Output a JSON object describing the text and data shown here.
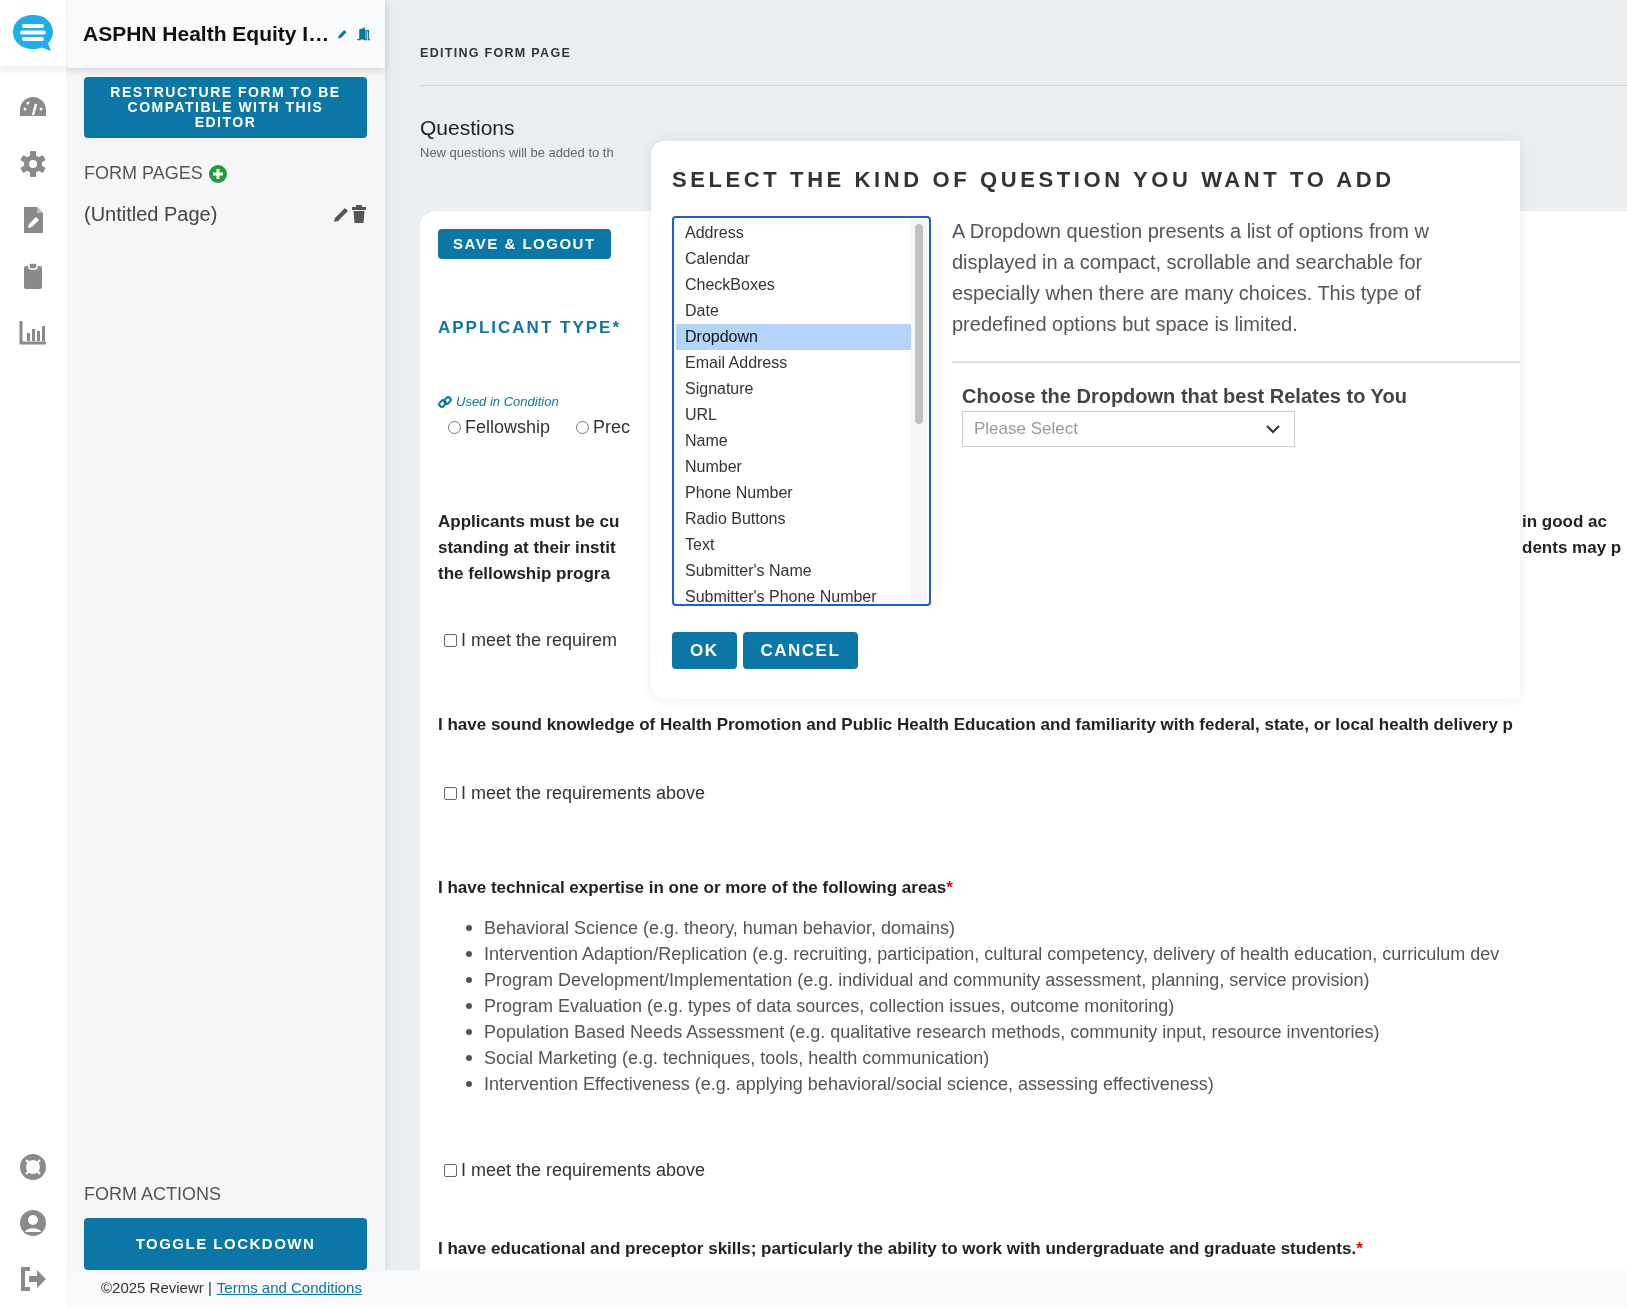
{
  "sidebar": {
    "title": "ASPHN Health Equity I…",
    "restructure_button": "RESTRUCTURE FORM TO BE COMPATIBLE WITH THIS EDITOR",
    "form_pages_heading": "FORM PAGES",
    "pages": [
      {
        "label": "(Untitled Page)"
      }
    ],
    "form_actions_heading": "FORM ACTIONS",
    "actions": [
      "TOGGLE LOCKDOWN"
    ]
  },
  "main": {
    "eyebrow": "EDITING FORM PAGE",
    "heading": "Questions",
    "subheading": "New questions will be added to th",
    "save_button": "SAVE & LOGOUT",
    "applicant_type": {
      "label": "APPLICANT TYPE*",
      "condition_note": "Used in Condition",
      "options": [
        {
          "label": "Fellowship",
          "selected": false
        },
        {
          "label": "Prec",
          "selected": false
        }
      ]
    },
    "questions": [
      {
        "kind": "split",
        "left_lines": [
          "Applicants must be cu",
          "standing at their instit",
          "the fellowship progra"
        ],
        "right_lines": [
          "in good ac",
          "dents may p"
        ],
        "checkbox": {
          "label": "I meet the requirem",
          "checked": false
        }
      },
      {
        "kind": "statement",
        "text": "I have sound knowledge of Health Promotion and Public Health Education and familiarity with federal, state, or local health delivery p",
        "checkbox": {
          "label": "I meet the requirements above",
          "checked": false
        }
      },
      {
        "kind": "list",
        "text": "I have technical expertise in one or more of the following areas",
        "required_mark": "*",
        "items": [
          "Behavioral Science (e.g. theory, human behavior, domains)",
          "Intervention Adaption/Replication (e.g. recruiting, participation, cultural competency, delivery of health education, curriculum dev",
          "Program Development/Implementation (e.g. individual and community assessment, planning, service provision)",
          "Program Evaluation (e.g. types of data sources, collection issues, outcome monitoring)",
          "Population Based Needs Assessment (e.g. qualitative research methods, community input, resource inventories)",
          "Social Marketing (e.g. techniques, tools, health communication)",
          "Intervention Effectiveness (e.g. applying behavioral/social science, assessing effectiveness)"
        ],
        "checkbox": {
          "label": "I meet the requirements above",
          "checked": false
        }
      },
      {
        "kind": "statement",
        "text": "I have educational and preceptor skills; particularly the ability to work with undergraduate and graduate students.",
        "required_mark": "*"
      }
    ]
  },
  "modal": {
    "title": "SELECT THE KIND OF QUESTION YOU WANT TO ADD",
    "question_types": [
      {
        "label": "Address",
        "selected": false
      },
      {
        "label": "Calendar",
        "selected": false
      },
      {
        "label": "CheckBoxes",
        "selected": false
      },
      {
        "label": "Date",
        "selected": false
      },
      {
        "label": "Dropdown",
        "selected": true
      },
      {
        "label": "Email Address",
        "selected": false
      },
      {
        "label": "Signature",
        "selected": false
      },
      {
        "label": "URL",
        "selected": false
      },
      {
        "label": "Name",
        "selected": false
      },
      {
        "label": "Number",
        "selected": false
      },
      {
        "label": "Phone Number",
        "selected": false
      },
      {
        "label": "Radio Buttons",
        "selected": false
      },
      {
        "label": "Text",
        "selected": false
      },
      {
        "label": "Submitter's Name",
        "selected": false
      },
      {
        "label": "Submitter's Phone Number",
        "selected": false
      }
    ],
    "description_lines": [
      "A Dropdown question presents a list of options from w",
      "displayed in a compact, scrollable and searchable for",
      "especially when there are many choices. This type of",
      "predefined options but space is limited."
    ],
    "preview": {
      "label": "Choose the Dropdown that best Relates to You",
      "placeholder": "Please Select"
    },
    "buttons": [
      "OK",
      "CANCEL"
    ]
  },
  "footer": {
    "copyright": "©2025 Reviewr |",
    "link": "Terms and Conditions"
  }
}
